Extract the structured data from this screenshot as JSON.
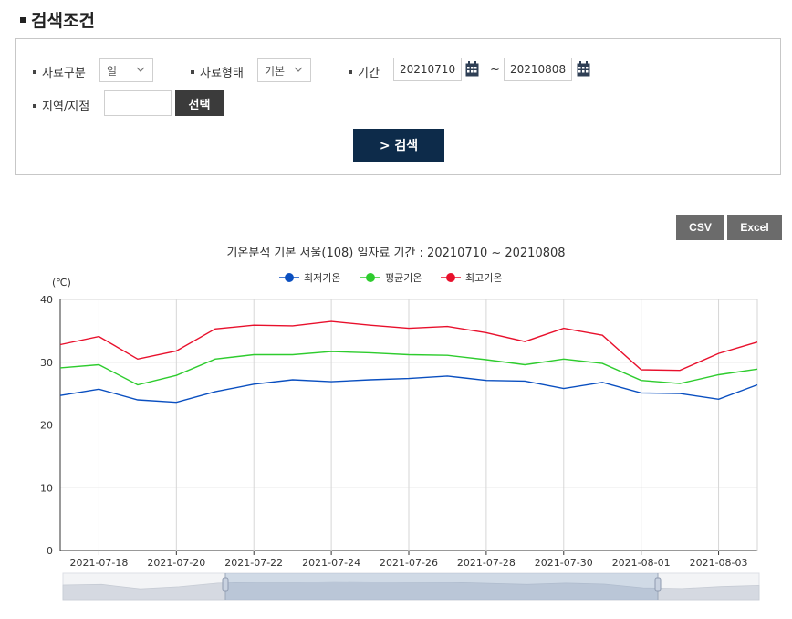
{
  "search": {
    "title": "검색조건",
    "data_type_label": "자료구분",
    "data_type_value": "일",
    "data_form_label": "자료형태",
    "data_form_value": "기본",
    "period_label": "기간",
    "date_from": "20210710",
    "date_sep": "~",
    "date_to": "20210808",
    "region_label": "지역/지점",
    "region_value": "",
    "select_button": "선택",
    "search_button": "> 검색"
  },
  "toolbar": {
    "csv_label": "CSV",
    "excel_label": "Excel"
  },
  "colors": {
    "min": "#0a4fc0",
    "avg": "#2ecc2e",
    "max": "#e8102c"
  },
  "chart_data": {
    "type": "line",
    "title": "기온분석 기본 서울(108) 일자료 기간 : 20210710 ~ 20210808",
    "ylabel": "(℃)",
    "xlabel": "",
    "ylim": [
      0,
      40
    ],
    "yticks": [
      0,
      10,
      20,
      30,
      40
    ],
    "grid": true,
    "legend_position": "top",
    "x": [
      "2021-07-17",
      "2021-07-18",
      "2021-07-19",
      "2021-07-20",
      "2021-07-21",
      "2021-07-22",
      "2021-07-23",
      "2021-07-24",
      "2021-07-25",
      "2021-07-26",
      "2021-07-27",
      "2021-07-28",
      "2021-07-29",
      "2021-07-30",
      "2021-07-31",
      "2021-08-01",
      "2021-08-02",
      "2021-08-03",
      "2021-08-04"
    ],
    "xtick_labels": [
      "2021-07-18",
      "2021-07-20",
      "2021-07-22",
      "2021-07-24",
      "2021-07-26",
      "2021-07-28",
      "2021-07-30",
      "2021-08-01",
      "2021-08-03"
    ],
    "series": [
      {
        "name": "최저기온",
        "color_key": "min",
        "values": [
          24.7,
          25.7,
          24.0,
          23.6,
          25.3,
          26.5,
          27.2,
          26.9,
          27.2,
          27.4,
          27.8,
          27.1,
          27.0,
          25.8,
          26.8,
          25.1,
          25.0,
          24.1,
          26.4
        ]
      },
      {
        "name": "평균기온",
        "color_key": "avg",
        "values": [
          29.1,
          29.6,
          26.4,
          27.9,
          30.5,
          31.2,
          31.2,
          31.7,
          31.5,
          31.2,
          31.1,
          30.4,
          29.6,
          30.5,
          29.8,
          27.1,
          26.6,
          28.0,
          28.9
        ]
      },
      {
        "name": "최고기온",
        "color_key": "max",
        "values": [
          32.8,
          34.1,
          30.5,
          31.8,
          35.3,
          35.9,
          35.8,
          36.5,
          35.9,
          35.4,
          35.7,
          34.7,
          33.3,
          35.4,
          34.3,
          28.8,
          28.7,
          31.4,
          33.2
        ]
      }
    ]
  }
}
